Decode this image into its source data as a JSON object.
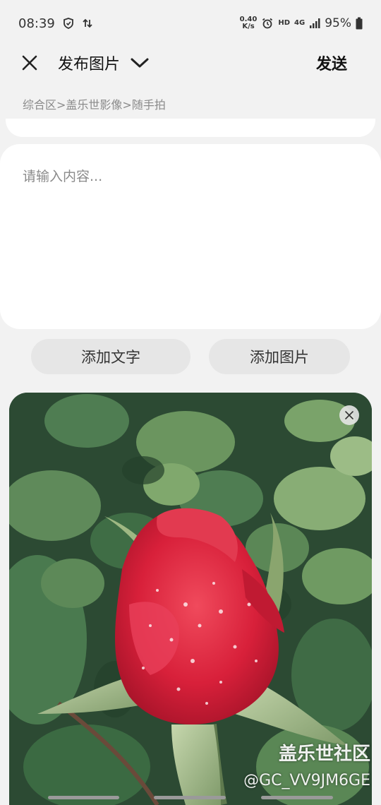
{
  "status_bar": {
    "time": "08:39",
    "net_speed_top": "0.40",
    "net_speed_bottom": "K/s",
    "hd_label": "HD",
    "network_label": "4G",
    "battery": "95%",
    "icons": [
      "vpn-shield-icon",
      "data-transfer-icon",
      "alarm-icon",
      "signal-icon",
      "battery-icon"
    ]
  },
  "header": {
    "title": "发布图片",
    "send_label": "发送"
  },
  "breadcrumb": "综合区>盖乐世影像>随手拍",
  "editor": {
    "placeholder": "请输入内容..."
  },
  "actions": {
    "add_text": "添加文字",
    "add_image": "添加图片"
  },
  "photo": {
    "watermark_title": "盖乐世社区",
    "watermark_user": "@GC_VV9JM6GE"
  },
  "colors": {
    "background": "#f2f2f2",
    "card": "#ffffff",
    "button": "#e6e6e6",
    "rose": "#d8203a"
  }
}
